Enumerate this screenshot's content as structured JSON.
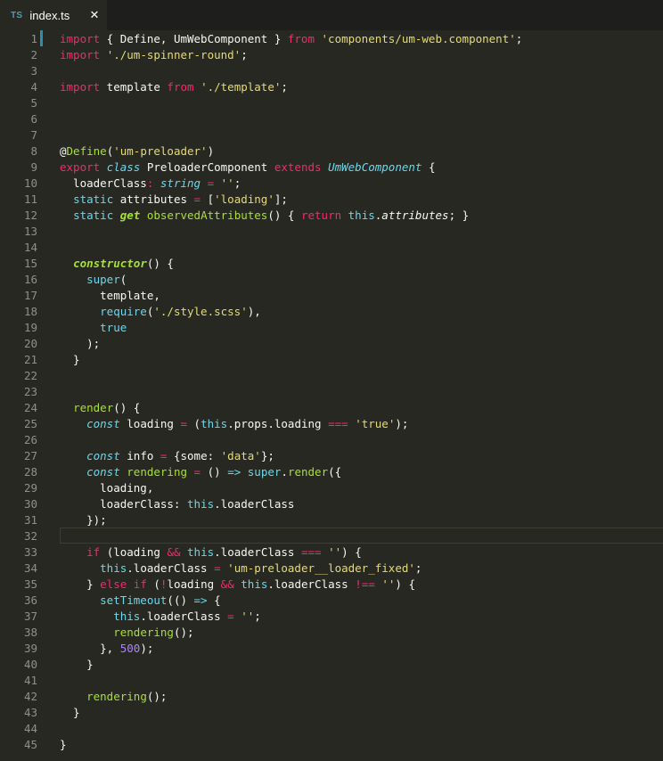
{
  "tab": {
    "badge": "TS",
    "title": "index.ts",
    "close_icon": "close-icon"
  },
  "colors": {
    "background": "#272822",
    "keyword": "#f92672",
    "string": "#e6db74",
    "function": "#a6e22e",
    "type": "#66d9ef",
    "number": "#ae81ff",
    "plain": "#f8f8f2",
    "line_number": "#90908a"
  },
  "editor": {
    "current_line": 32,
    "lines": [
      [
        [
          "import",
          "kw"
        ],
        [
          " { Define, UmWebComponent } ",
          ""
        ],
        [
          "from",
          "kw"
        ],
        [
          " ",
          ""
        ],
        [
          "'components/um-web.component'",
          "str"
        ],
        [
          ";",
          ""
        ]
      ],
      [
        [
          "import",
          "kw"
        ],
        [
          " ",
          ""
        ],
        [
          "'./um-spinner-round'",
          "str"
        ],
        [
          ";",
          ""
        ]
      ],
      [],
      [
        [
          "import",
          "kw"
        ],
        [
          " template ",
          ""
        ],
        [
          "from",
          "kw"
        ],
        [
          " ",
          ""
        ],
        [
          "'./template'",
          "str"
        ],
        [
          ";",
          ""
        ]
      ],
      [],
      [],
      [],
      [
        [
          "@",
          ""
        ],
        [
          "Define",
          "fn"
        ],
        [
          "(",
          ""
        ],
        [
          "'um-preloader'",
          "str"
        ],
        [
          ")",
          ""
        ]
      ],
      [
        [
          "export",
          "kw"
        ],
        [
          " ",
          ""
        ],
        [
          "class",
          "ti"
        ],
        [
          " PreloaderComponent ",
          ""
        ],
        [
          "extends",
          "kw"
        ],
        [
          " ",
          ""
        ],
        [
          "UmWebComponent",
          "ti"
        ],
        [
          " {",
          ""
        ]
      ],
      [
        [
          "  loaderClass",
          ""
        ],
        [
          ":",
          "kw"
        ],
        [
          " ",
          ""
        ],
        [
          "string",
          "ti"
        ],
        [
          " ",
          ""
        ],
        [
          "=",
          "kw"
        ],
        [
          " ",
          ""
        ],
        [
          "''",
          "str"
        ],
        [
          ";",
          ""
        ]
      ],
      [
        [
          "  ",
          ""
        ],
        [
          "static",
          "ty"
        ],
        [
          " attributes ",
          ""
        ],
        [
          "=",
          "kw"
        ],
        [
          " [",
          ""
        ],
        [
          "'loading'",
          "str"
        ],
        [
          "];",
          ""
        ]
      ],
      [
        [
          "  ",
          ""
        ],
        [
          "static",
          "ty"
        ],
        [
          " ",
          ""
        ],
        [
          "get",
          "fb"
        ],
        [
          " ",
          ""
        ],
        [
          "observedAttributes",
          "fn"
        ],
        [
          "() { ",
          ""
        ],
        [
          "return",
          "kw"
        ],
        [
          " ",
          ""
        ],
        [
          "this",
          "ty"
        ],
        [
          ".",
          ""
        ],
        [
          "attributes",
          "i"
        ],
        [
          "; }",
          ""
        ]
      ],
      [],
      [],
      [
        [
          "  ",
          ""
        ],
        [
          "constructor",
          "fb"
        ],
        [
          "() {",
          ""
        ]
      ],
      [
        [
          "    ",
          ""
        ],
        [
          "super",
          "ty"
        ],
        [
          "(",
          ""
        ]
      ],
      [
        [
          "      template,",
          ""
        ]
      ],
      [
        [
          "      ",
          ""
        ],
        [
          "require",
          "ty"
        ],
        [
          "(",
          ""
        ],
        [
          "'./style.scss'",
          "str"
        ],
        [
          "),",
          ""
        ]
      ],
      [
        [
          "      ",
          ""
        ],
        [
          "true",
          "ty"
        ]
      ],
      [
        [
          "    );",
          ""
        ]
      ],
      [
        [
          "  }",
          ""
        ]
      ],
      [],
      [],
      [
        [
          "  ",
          ""
        ],
        [
          "render",
          "fn"
        ],
        [
          "() {",
          ""
        ]
      ],
      [
        [
          "    ",
          ""
        ],
        [
          "const",
          "ti"
        ],
        [
          " loading ",
          ""
        ],
        [
          "=",
          "kw"
        ],
        [
          " (",
          ""
        ],
        [
          "this",
          "ty"
        ],
        [
          ".props.loading ",
          ""
        ],
        [
          "===",
          "kw"
        ],
        [
          " ",
          ""
        ],
        [
          "'true'",
          "str"
        ],
        [
          ");",
          ""
        ]
      ],
      [],
      [
        [
          "    ",
          ""
        ],
        [
          "const",
          "ti"
        ],
        [
          " info ",
          ""
        ],
        [
          "=",
          "kw"
        ],
        [
          " {some: ",
          ""
        ],
        [
          "'data'",
          "str"
        ],
        [
          "};",
          ""
        ]
      ],
      [
        [
          "    ",
          ""
        ],
        [
          "const",
          "ti"
        ],
        [
          " ",
          ""
        ],
        [
          "rendering",
          "fn"
        ],
        [
          " ",
          ""
        ],
        [
          "=",
          "kw"
        ],
        [
          " () ",
          ""
        ],
        [
          "=>",
          "ty"
        ],
        [
          " ",
          ""
        ],
        [
          "super",
          "ty"
        ],
        [
          ".",
          ""
        ],
        [
          "render",
          "fn"
        ],
        [
          "({",
          ""
        ]
      ],
      [
        [
          "      loading,",
          ""
        ]
      ],
      [
        [
          "      loaderClass: ",
          ""
        ],
        [
          "this",
          "ty"
        ],
        [
          ".loaderClass",
          ""
        ]
      ],
      [
        [
          "    });",
          ""
        ]
      ],
      [],
      [
        [
          "    ",
          ""
        ],
        [
          "if",
          "kw"
        ],
        [
          " (loading ",
          ""
        ],
        [
          "&&",
          "kw"
        ],
        [
          " ",
          ""
        ],
        [
          "this",
          "ty"
        ],
        [
          ".loaderClass ",
          ""
        ],
        [
          "===",
          "kw"
        ],
        [
          " ",
          ""
        ],
        [
          "''",
          "str"
        ],
        [
          ") {",
          ""
        ]
      ],
      [
        [
          "      ",
          ""
        ],
        [
          "this",
          "ty"
        ],
        [
          ".loaderClass ",
          ""
        ],
        [
          "=",
          "kw"
        ],
        [
          " ",
          ""
        ],
        [
          "'um-preloader__loader_fixed'",
          "str"
        ],
        [
          ";",
          ""
        ]
      ],
      [
        [
          "    } ",
          ""
        ],
        [
          "else",
          "kw"
        ],
        [
          " ",
          ""
        ],
        [
          "if",
          "kw"
        ],
        [
          " (",
          ""
        ],
        [
          "!",
          "kw"
        ],
        [
          "loading ",
          ""
        ],
        [
          "&&",
          "kw"
        ],
        [
          " ",
          ""
        ],
        [
          "this",
          "ty"
        ],
        [
          ".loaderClass ",
          ""
        ],
        [
          "!==",
          "kw"
        ],
        [
          " ",
          ""
        ],
        [
          "''",
          "str"
        ],
        [
          ") {",
          ""
        ]
      ],
      [
        [
          "      ",
          ""
        ],
        [
          "setTimeout",
          "ty"
        ],
        [
          "(() ",
          ""
        ],
        [
          "=>",
          "ty"
        ],
        [
          " {",
          ""
        ]
      ],
      [
        [
          "        ",
          ""
        ],
        [
          "this",
          "ty"
        ],
        [
          ".loaderClass ",
          ""
        ],
        [
          "=",
          "kw"
        ],
        [
          " ",
          ""
        ],
        [
          "''",
          "str"
        ],
        [
          ";",
          ""
        ]
      ],
      [
        [
          "        ",
          ""
        ],
        [
          "rendering",
          "fn"
        ],
        [
          "();",
          ""
        ]
      ],
      [
        [
          "      }, ",
          ""
        ],
        [
          "500",
          "num"
        ],
        [
          ");",
          ""
        ]
      ],
      [
        [
          "    }",
          ""
        ]
      ],
      [],
      [
        [
          "    ",
          ""
        ],
        [
          "rendering",
          "fn"
        ],
        [
          "();",
          ""
        ]
      ],
      [
        [
          "  }",
          ""
        ]
      ],
      [],
      [
        [
          "}",
          ""
        ]
      ]
    ]
  }
}
